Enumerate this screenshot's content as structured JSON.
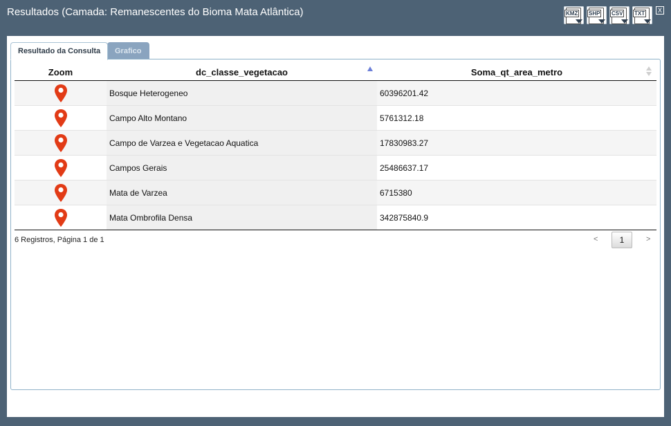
{
  "window": {
    "title": "Resultados (Camada: Remanescentes do Bioma Mata Atlântica)",
    "close_label": "X"
  },
  "exports": [
    {
      "label": "KMZ"
    },
    {
      "label": "SHP"
    },
    {
      "label": "CSV"
    },
    {
      "label": "TXT"
    }
  ],
  "tabs": [
    {
      "label": "Resultado da Consulta",
      "active": true
    },
    {
      "label": "Grafico",
      "active": false
    }
  ],
  "table": {
    "headers": {
      "zoom": "Zoom",
      "classe": "dc_classe_vegetacao",
      "area": "Soma_qt_area_metro"
    },
    "rows": [
      {
        "classe": "Bosque Heterogeneo",
        "area": "60396201.42"
      },
      {
        "classe": "Campo Alto Montano",
        "area": "5761312.18"
      },
      {
        "classe": "Campo de Varzea e Vegetacao Aquatica",
        "area": "17830983.27"
      },
      {
        "classe": "Campos Gerais",
        "area": "25486637.17"
      },
      {
        "classe": "Mata de Varzea",
        "area": "6715380"
      },
      {
        "classe": "Mata Ombrofila Densa",
        "area": "342875840.9"
      }
    ]
  },
  "footer": {
    "info": "6 Registros, Página 1 de 1",
    "prev": "<",
    "page": "1",
    "next": ">"
  },
  "colors": {
    "frame": "#4d6275",
    "pin": "#e23b16",
    "tab_inactive": "#8aa4bf",
    "sort_active": "#6c7fd8"
  },
  "icons": {
    "zoom": "map-pin-icon",
    "export": "file-download-icon",
    "close": "close-icon"
  }
}
